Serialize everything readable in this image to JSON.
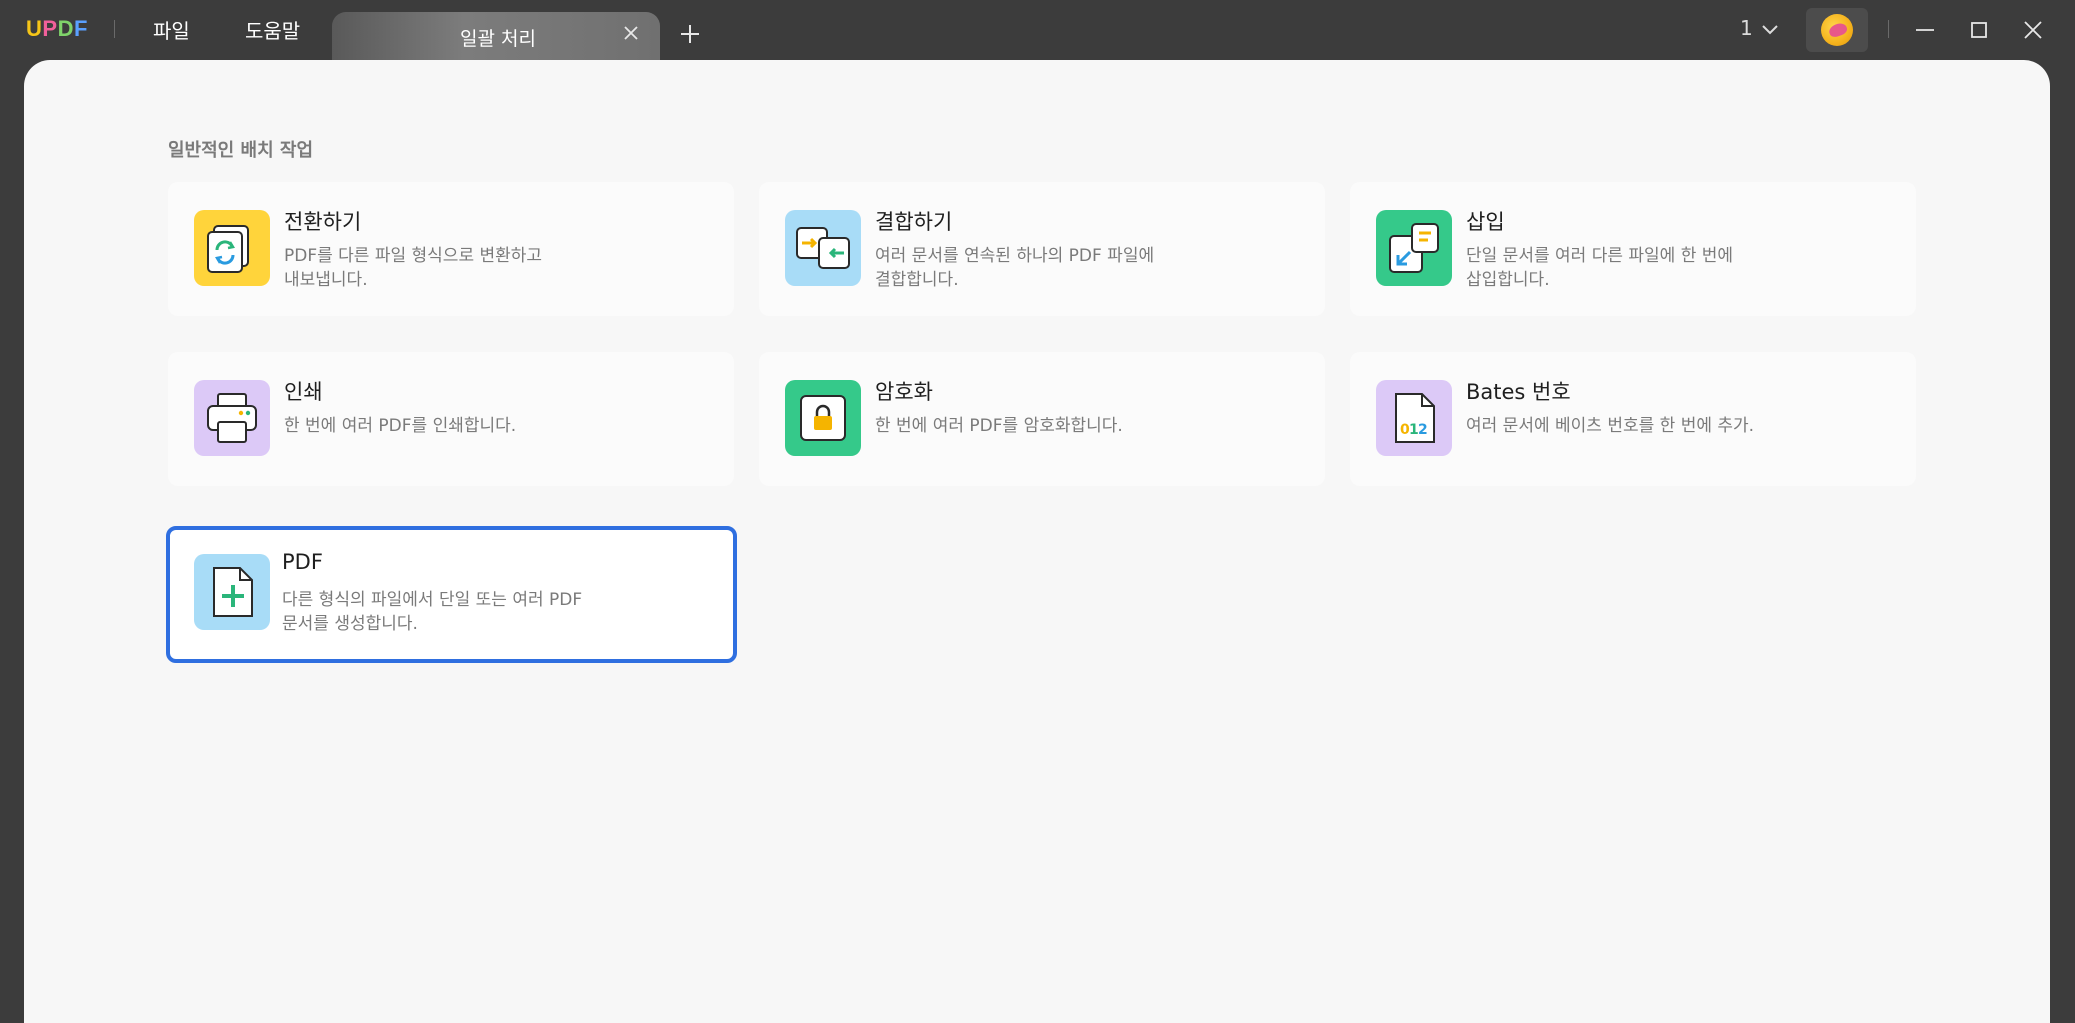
{
  "app": {
    "logo": "UPDF",
    "menu": {
      "file": "파일",
      "help": "도움말"
    },
    "tab": {
      "title": "일괄 처리"
    },
    "page_indicator": "1"
  },
  "colors": {
    "accent": "#2f6fe0",
    "titlebar": "#3c3c3c",
    "content_bg": "#f7f7f7",
    "icon_convert_bg": "#ffd43b",
    "icon_combine_bg": "#a8dcf7",
    "icon_insert_bg": "#35c98a",
    "icon_print_bg": "#dcc9f7",
    "icon_encrypt_bg": "#35c98a",
    "icon_bates_bg": "#dcc9f7",
    "icon_create_bg": "#a8dcf7"
  },
  "main": {
    "section_title": "일반적인 배치 작업",
    "cards": [
      {
        "title": "전환하기",
        "desc_line1": "PDF를 다른 파일 형식으로 변환하고",
        "desc_line2": "내보냅니다.",
        "icon": "convert-icon"
      },
      {
        "title": "결합하기",
        "desc_line1": "여러 문서를 연속된 하나의 PDF 파일에",
        "desc_line2": "결합합니다.",
        "icon": "combine-icon"
      },
      {
        "title": "삽입",
        "desc_line1": "단일 문서를 여러 다른 파일에 한 번에",
        "desc_line2": "삽입합니다.",
        "icon": "insert-icon"
      },
      {
        "title": "인쇄",
        "desc_line1": "한 번에 여러 PDF를 인쇄합니다.",
        "desc_line2": "",
        "icon": "printer-icon"
      },
      {
        "title": "암호화",
        "desc_line1": "한 번에 여러 PDF를 암호화합니다.",
        "desc_line2": "",
        "icon": "lock-icon"
      },
      {
        "title": "Bates 번호",
        "desc_line1": "여러 문서에 베이츠 번호를 한 번에 추가.",
        "desc_line2": "",
        "icon": "bates-number-icon"
      },
      {
        "title": "PDF",
        "desc_line1": "다른 형식의 파일에서 단일 또는 여러 PDF",
        "desc_line2": "문서를 생성합니다.",
        "icon": "create-pdf-icon"
      }
    ]
  }
}
